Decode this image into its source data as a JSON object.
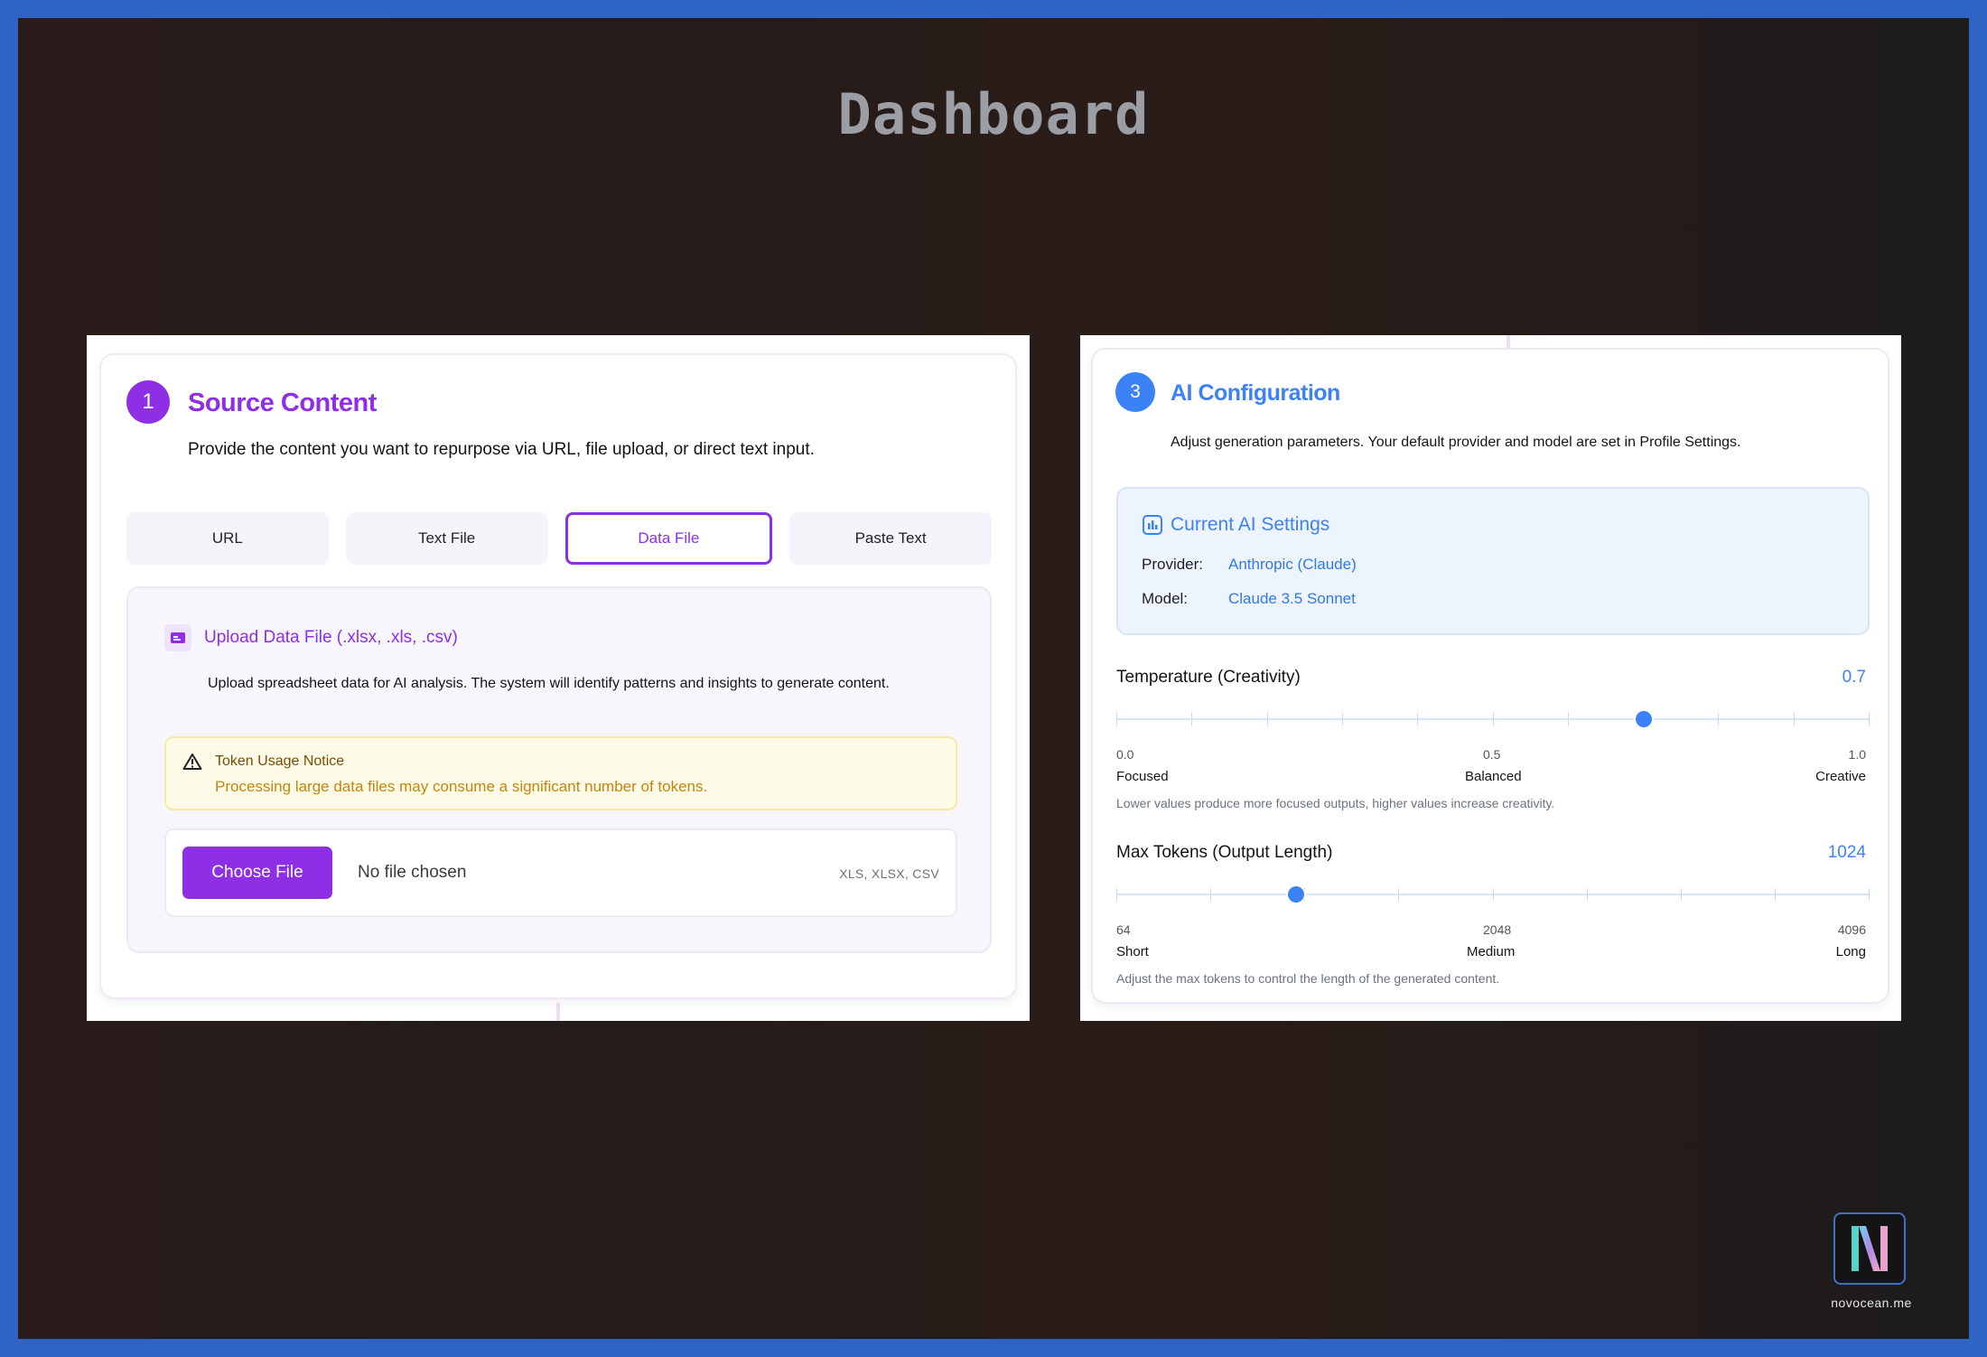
{
  "page": {
    "title": "Dashboard"
  },
  "source": {
    "step": "1",
    "title": "Source Content",
    "description": "Provide the content you want to repurpose via URL, file upload, or direct text input.",
    "tabs": [
      {
        "label": "URL",
        "active": false
      },
      {
        "label": "Text File",
        "active": false
      },
      {
        "label": "Data File",
        "active": true
      },
      {
        "label": "Paste Text",
        "active": false
      }
    ],
    "upload": {
      "title": "Upload Data File (.xlsx, .xls, .csv)",
      "description": "Upload spreadsheet data for AI analysis. The system will identify patterns and insights to generate content.",
      "notice_title": "Token Usage Notice",
      "notice_text": "Processing large data files may consume a significant number of tokens.",
      "choose_label": "Choose File",
      "file_status": "No file chosen",
      "formats": "XLS, XLSX, CSV"
    }
  },
  "ai": {
    "step": "3",
    "title": "AI Configuration",
    "description": "Adjust generation parameters. Your default provider and model are set in Profile Settings.",
    "settings": {
      "title": "Current AI Settings",
      "provider_label": "Provider:",
      "provider_value": "Anthropic (Claude)",
      "model_label": "Model:",
      "model_value": "Claude 3.5 Sonnet"
    },
    "temperature": {
      "label": "Temperature (Creativity)",
      "value": "0.7",
      "min": 0.0,
      "max": 1.0,
      "current": 0.7,
      "ticks": [
        "0.0",
        "0.5",
        "1.0"
      ],
      "words": [
        "Focused",
        "Balanced",
        "Creative"
      ],
      "hint": "Lower values produce more focused outputs, higher values increase creativity."
    },
    "max_tokens": {
      "label": "Max Tokens (Output Length)",
      "value": "1024",
      "min": 64,
      "max": 4096,
      "current": 1024,
      "ticks": [
        "64",
        "2048",
        "4096"
      ],
      "words": [
        "Short",
        "Medium",
        "Long"
      ],
      "hint": "Adjust the max tokens to control the length of the generated content."
    }
  },
  "branding": {
    "caption": "novocean.me"
  },
  "colors": {
    "purple": "#8e2fe6",
    "blue": "#3b82f6",
    "frame": "#2f63c4"
  }
}
